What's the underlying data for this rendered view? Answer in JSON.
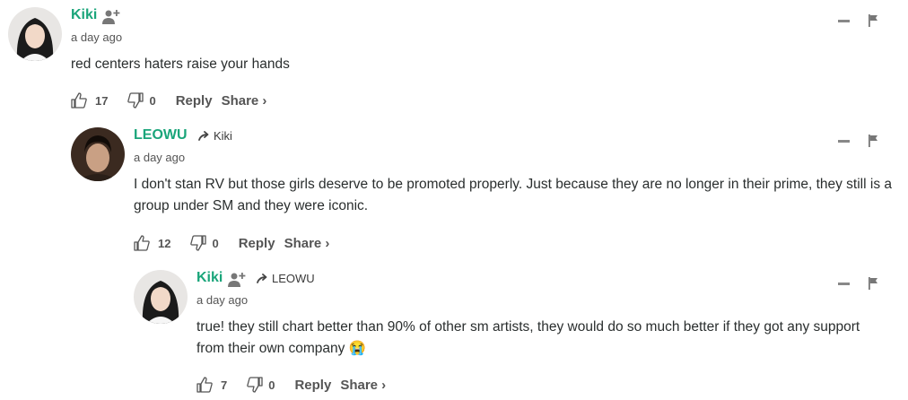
{
  "comments": [
    {
      "author": "Kiki",
      "time": "a day ago",
      "reply_to": "",
      "text": "red centers haters raise your hands",
      "upvotes": "17",
      "downvotes": "0",
      "reply_label": "Reply",
      "share_label": "Share ›"
    },
    {
      "author": "LEOWU",
      "time": "a day ago",
      "reply_to": "Kiki",
      "text": "I don't stan RV but those girls deserve to be promoted properly. Just because they are no longer in their prime, they still is a group under SM and they were iconic.",
      "upvotes": "12",
      "downvotes": "0",
      "reply_label": "Reply",
      "share_label": "Share ›"
    },
    {
      "author": "Kiki",
      "time": "a day ago",
      "reply_to": "LEOWU",
      "text": "true! they still chart better than 90% of other sm artists, they would do so much better if they got any support from their own company 😭",
      "upvotes": "7",
      "downvotes": "0",
      "reply_label": "Reply",
      "share_label": "Share ›"
    }
  ],
  "icons": {
    "follow": "add-user-icon",
    "reply_arrow": "reply-arrow-icon",
    "upvote": "thumbs-up-icon",
    "downvote": "thumbs-down-icon",
    "collapse": "minus-icon",
    "flag": "flag-icon"
  },
  "colors": {
    "author": "#1aa57a",
    "text": "#2a2e2e",
    "meta": "#555555"
  }
}
